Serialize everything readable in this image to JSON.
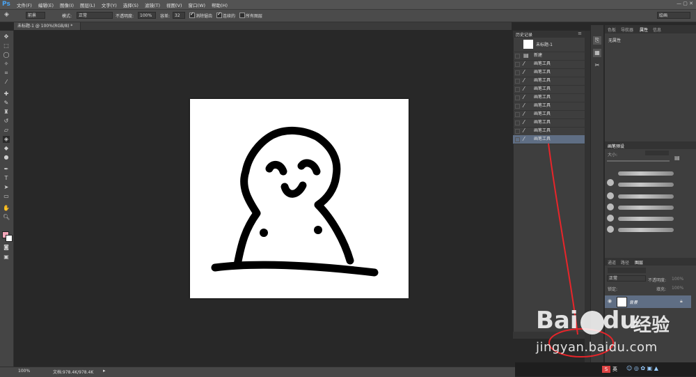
{
  "app": {
    "logo": "Ps"
  },
  "menu": [
    "文件(F)",
    "编辑(E)",
    "图像(I)",
    "图层(L)",
    "文字(Y)",
    "选择(S)",
    "滤镜(T)",
    "视图(V)",
    "窗口(W)",
    "帮助(H)"
  ],
  "options": {
    "preset": "前景",
    "mode_label": "模式:",
    "mode_value": "正常",
    "opacity_label": "不透明度:",
    "opacity_value": "100%",
    "tolerance_label": "容差:",
    "tolerance_value": "32",
    "antialias_label": "消除锯齿",
    "contiguous_label": "连续的",
    "all_layers_label": "所有图层",
    "workspace": "绘画"
  },
  "document": {
    "tab_title": "未标题-1 @ 100%(RGB/8) *"
  },
  "history": {
    "title": "历史记录",
    "snapshot": "未标题-1",
    "items": [
      {
        "icon": "new-doc-icon",
        "label": "新建"
      },
      {
        "icon": "brush-icon",
        "label": "画笔工具"
      },
      {
        "icon": "brush-icon",
        "label": "画笔工具"
      },
      {
        "icon": "brush-icon",
        "label": "画笔工具"
      },
      {
        "icon": "brush-icon",
        "label": "画笔工具"
      },
      {
        "icon": "brush-icon",
        "label": "画笔工具"
      },
      {
        "icon": "brush-icon",
        "label": "画笔工具"
      },
      {
        "icon": "brush-icon",
        "label": "画笔工具"
      },
      {
        "icon": "brush-icon",
        "label": "画笔工具"
      },
      {
        "icon": "brush-icon",
        "label": "画笔工具"
      },
      {
        "icon": "brush-icon",
        "label": "画笔工具"
      }
    ]
  },
  "properties": {
    "tabs": [
      "色板",
      "导航器",
      "属性",
      "信息"
    ],
    "body": "无属性"
  },
  "brush_presets": {
    "title": "画笔预设",
    "size_label": "大小:"
  },
  "layers": {
    "tabs": [
      "通道",
      "路径",
      "图层"
    ],
    "blend": "正常",
    "opacity_label": "不透明度:",
    "opacity_value": "100%",
    "lock_label": "锁定:",
    "fill_label": "填充:",
    "fill_value": "100%",
    "layer_name": "背景"
  },
  "status": {
    "zoom": "100%",
    "doc_info": "文档:978.4K/978.4K"
  },
  "watermark": {
    "brand": "Bai",
    "brand2": "du",
    "brand3": "经验",
    "url": "jingyan.baidu.com"
  },
  "taskbar": {
    "ime": "英"
  }
}
